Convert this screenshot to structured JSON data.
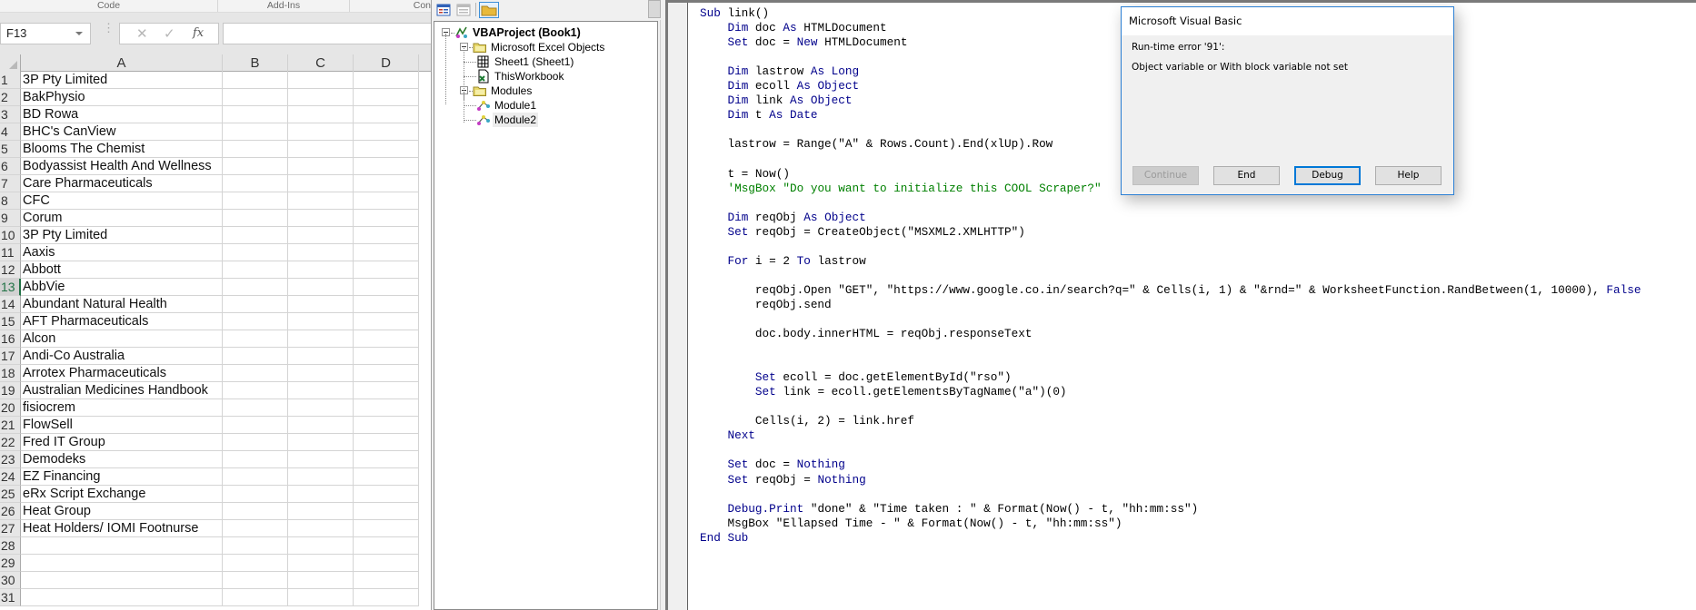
{
  "excel": {
    "ribbon_groups": [
      "Code",
      "Add-Ins",
      "Con"
    ],
    "name_box": "F13",
    "formula_bar": {
      "cancel_icon": "✕",
      "enter_icon": "✓",
      "fx_label": "fx",
      "value": ""
    },
    "columns": [
      "A",
      "B",
      "C",
      "D"
    ],
    "active_row": 13,
    "rows": [
      {
        "num": "1",
        "a": "3P Pty Limited"
      },
      {
        "num": "2",
        "a": "BakPhysio"
      },
      {
        "num": "3",
        "a": "BD Rowa"
      },
      {
        "num": "4",
        "a": "BHC's CanView"
      },
      {
        "num": "5",
        "a": "Blooms The Chemist"
      },
      {
        "num": "6",
        "a": "Bodyassist Health And Wellness"
      },
      {
        "num": "7",
        "a": "Care Pharmaceuticals"
      },
      {
        "num": "8",
        "a": "CFC"
      },
      {
        "num": "9",
        "a": "Corum"
      },
      {
        "num": "10",
        "a": "3P Pty Limited"
      },
      {
        "num": "11",
        "a": "Aaxis"
      },
      {
        "num": "12",
        "a": "Abbott"
      },
      {
        "num": "13",
        "a": "AbbVie"
      },
      {
        "num": "14",
        "a": "Abundant Natural Health"
      },
      {
        "num": "15",
        "a": "AFT Pharmaceuticals"
      },
      {
        "num": "16",
        "a": "Alcon"
      },
      {
        "num": "17",
        "a": "Andi-Co Australia"
      },
      {
        "num": "18",
        "a": "Arrotex Pharmaceuticals"
      },
      {
        "num": "19",
        "a": "Australian Medicines Handbook"
      },
      {
        "num": "20",
        "a": "fisiocrem"
      },
      {
        "num": "21",
        "a": "FlowSell"
      },
      {
        "num": "22",
        "a": "Fred IT Group"
      },
      {
        "num": "23",
        "a": "Demodeks"
      },
      {
        "num": "24",
        "a": "EZ Financing"
      },
      {
        "num": "25",
        "a": "eRx Script Exchange"
      },
      {
        "num": "26",
        "a": "Heat Group"
      },
      {
        "num": "27",
        "a": "Heat Holders/ IOMI Footnurse"
      },
      {
        "num": "28",
        "a": ""
      },
      {
        "num": "29",
        "a": ""
      },
      {
        "num": "30",
        "a": ""
      },
      {
        "num": "31",
        "a": ""
      }
    ]
  },
  "project": {
    "toolbar": [
      "view-code-icon",
      "view-object-icon",
      "toggle-folders-icon"
    ],
    "tree": [
      {
        "label": "VBAProject (Book1)",
        "icon": "vba-project-icon",
        "level": 0,
        "expandable": true,
        "bold": true
      },
      {
        "label": "Microsoft Excel Objects",
        "icon": "folder-icon",
        "level": 1,
        "expandable": true
      },
      {
        "label": "Sheet1 (Sheet1)",
        "icon": "worksheet-icon",
        "level": 2
      },
      {
        "label": "ThisWorkbook",
        "icon": "workbook-icon",
        "level": 2
      },
      {
        "label": "Modules",
        "icon": "folder-icon",
        "level": 1,
        "expandable": true
      },
      {
        "label": "Module1",
        "icon": "module-icon",
        "level": 2
      },
      {
        "label": "Module2",
        "icon": "module-icon",
        "level": 2,
        "selected": true
      }
    ]
  },
  "code": {
    "lines": [
      [
        [
          "kw",
          "Sub"
        ],
        [
          "t",
          " link()"
        ]
      ],
      [
        [
          "t",
          "    "
        ],
        [
          "kw",
          "Dim"
        ],
        [
          "t",
          " doc "
        ],
        [
          "kw",
          "As"
        ],
        [
          "t",
          " HTMLDocument"
        ]
      ],
      [
        [
          "t",
          "    "
        ],
        [
          "kw",
          "Set"
        ],
        [
          "t",
          " doc = "
        ],
        [
          "kw",
          "New"
        ],
        [
          "t",
          " HTMLDocument"
        ]
      ],
      [
        [
          "t",
          ""
        ]
      ],
      [
        [
          "t",
          "    "
        ],
        [
          "kw",
          "Dim"
        ],
        [
          "t",
          " lastrow "
        ],
        [
          "kw",
          "As Long"
        ]
      ],
      [
        [
          "t",
          "    "
        ],
        [
          "kw",
          "Dim"
        ],
        [
          "t",
          " ecoll "
        ],
        [
          "kw",
          "As Object"
        ]
      ],
      [
        [
          "t",
          "    "
        ],
        [
          "kw",
          "Dim"
        ],
        [
          "t",
          " link "
        ],
        [
          "kw",
          "As Object"
        ]
      ],
      [
        [
          "t",
          "    "
        ],
        [
          "kw",
          "Dim"
        ],
        [
          "t",
          " t "
        ],
        [
          "kw",
          "As Date"
        ]
      ],
      [
        [
          "t",
          ""
        ]
      ],
      [
        [
          "t",
          "    lastrow = Range(\"A\" & Rows.Count).End(xlUp).Row"
        ]
      ],
      [
        [
          "t",
          ""
        ]
      ],
      [
        [
          "t",
          "    t = Now()"
        ]
      ],
      [
        [
          "t",
          "    "
        ],
        [
          "cm",
          "'MsgBox \"Do you want to initialize this COOL Scraper?\""
        ]
      ],
      [
        [
          "t",
          ""
        ]
      ],
      [
        [
          "t",
          "    "
        ],
        [
          "kw",
          "Dim"
        ],
        [
          "t",
          " reqObj "
        ],
        [
          "kw",
          "As Object"
        ]
      ],
      [
        [
          "t",
          "    "
        ],
        [
          "kw",
          "Set"
        ],
        [
          "t",
          " reqObj = CreateObject(\"MSXML2.XMLHTTP\")"
        ]
      ],
      [
        [
          "t",
          ""
        ]
      ],
      [
        [
          "t",
          "    "
        ],
        [
          "kw",
          "For"
        ],
        [
          "t",
          " i = 2 "
        ],
        [
          "kw",
          "To"
        ],
        [
          "t",
          " lastrow"
        ]
      ],
      [
        [
          "t",
          ""
        ]
      ],
      [
        [
          "t",
          "        reqObj.Open \"GET\", \"https://www.google.co.in/search?q=\" & Cells(i, 1) & \"&rnd=\" & WorksheetFunction.RandBetween(1, 10000), "
        ],
        [
          "kw",
          "False"
        ]
      ],
      [
        [
          "t",
          "        reqObj.send"
        ]
      ],
      [
        [
          "t",
          ""
        ]
      ],
      [
        [
          "t",
          "        doc.body.innerHTML = reqObj.responseText"
        ]
      ],
      [
        [
          "t",
          ""
        ]
      ],
      [
        [
          "t",
          ""
        ]
      ],
      [
        [
          "t",
          "        "
        ],
        [
          "kw",
          "Set"
        ],
        [
          "t",
          " ecoll = doc.getElementById(\"rso\")"
        ]
      ],
      [
        [
          "t",
          "        "
        ],
        [
          "kw",
          "Set"
        ],
        [
          "t",
          " link = ecoll.getElementsByTagName(\"a\")(0)"
        ]
      ],
      [
        [
          "t",
          ""
        ]
      ],
      [
        [
          "t",
          "        Cells(i, 2) = link.href"
        ]
      ],
      [
        [
          "t",
          "    "
        ],
        [
          "kw",
          "Next"
        ]
      ],
      [
        [
          "t",
          ""
        ]
      ],
      [
        [
          "t",
          "    "
        ],
        [
          "kw",
          "Set"
        ],
        [
          "t",
          " doc = "
        ],
        [
          "kw",
          "Nothing"
        ]
      ],
      [
        [
          "t",
          "    "
        ],
        [
          "kw",
          "Set"
        ],
        [
          "t",
          " reqObj = "
        ],
        [
          "kw",
          "Nothing"
        ]
      ],
      [
        [
          "t",
          ""
        ]
      ],
      [
        [
          "t",
          "    "
        ],
        [
          "kw",
          "Debug.Print"
        ],
        [
          "t",
          " \"done\" & \"Time taken : \" & Format(Now() - t, \"hh:mm:ss\")"
        ]
      ],
      [
        [
          "t",
          "    MsgBox \"Ellapsed Time - \" & Format(Now() - t, \"hh:mm:ss\")"
        ]
      ],
      [
        [
          "kw",
          "End Sub"
        ]
      ]
    ]
  },
  "dialog": {
    "title": "Microsoft Visual Basic",
    "error_line": "Run-time error '91':",
    "message": "Object variable or With block variable not set",
    "buttons": {
      "continue": "Continue",
      "end": "End",
      "debug": "Debug",
      "help": "Help"
    }
  },
  "colors": {
    "keyword": "#00008b",
    "comment": "#008000",
    "dialog_border": "#2b7fd4",
    "excel_active": "#217346"
  }
}
